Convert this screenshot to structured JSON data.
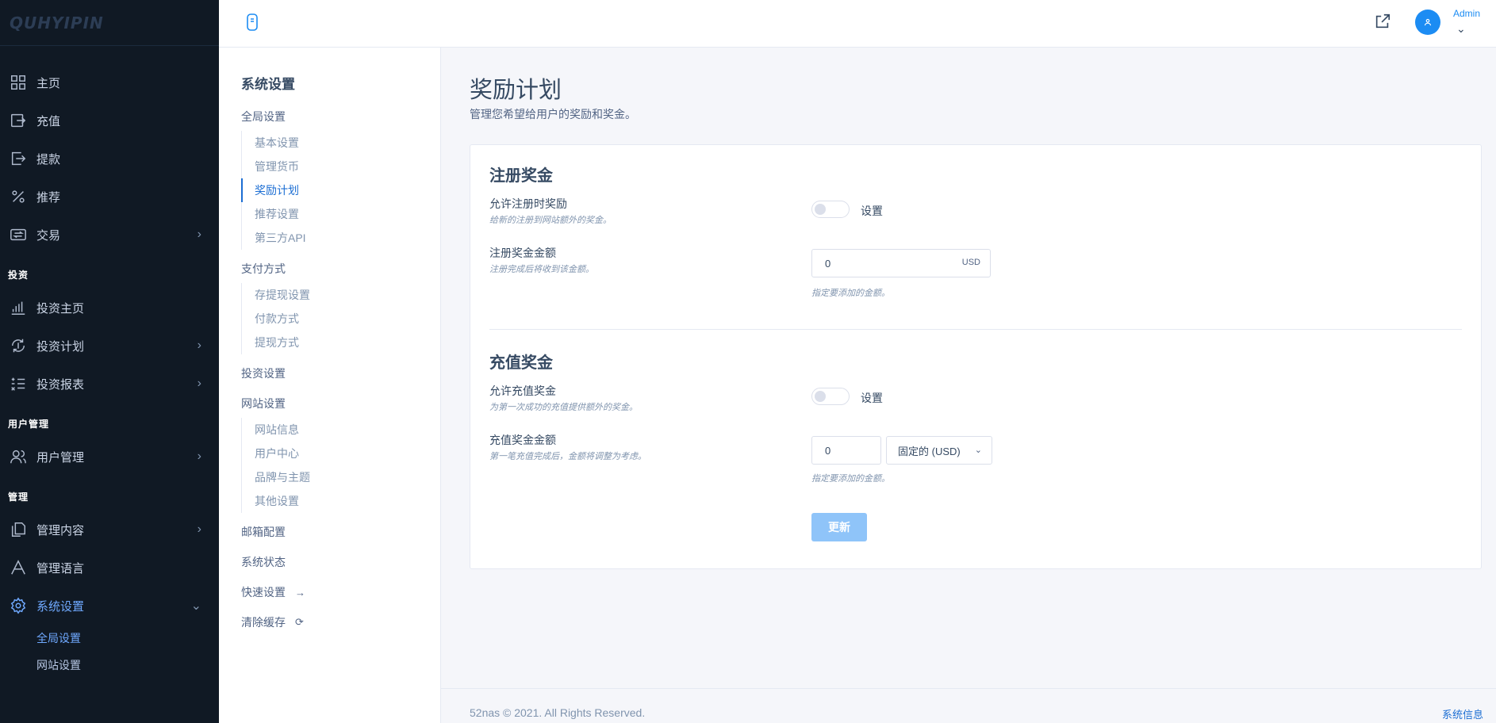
{
  "brand": {
    "name": "QUHYIPIN"
  },
  "sidebar": {
    "items": [
      {
        "label": "主页",
        "icon": "grid-icon"
      },
      {
        "label": "充值",
        "icon": "deposit-icon"
      },
      {
        "label": "提款",
        "icon": "withdraw-icon"
      },
      {
        "label": "推荐",
        "icon": "percent-icon"
      },
      {
        "label": "交易",
        "icon": "exchange-icon"
      }
    ],
    "heading_invest": "投资",
    "invest_items": [
      {
        "label": "投资主页",
        "icon": "bar-chart-icon"
      },
      {
        "label": "投资计划",
        "icon": "plan-icon"
      },
      {
        "label": "投资报表",
        "icon": "report-icon"
      }
    ],
    "heading_users": "用户管理",
    "user_items": [
      {
        "label": "用户管理",
        "icon": "users-icon"
      }
    ],
    "heading_manage": "管理",
    "manage_items": [
      {
        "label": "管理内容",
        "icon": "pages-icon"
      },
      {
        "label": "管理语言",
        "icon": "language-icon"
      },
      {
        "label": "系统设置",
        "icon": "gear-icon"
      }
    ],
    "settings_sub": [
      "全局设置",
      "网站设置"
    ]
  },
  "header": {
    "user_name": "Admin"
  },
  "submenu": {
    "title": "系统设置",
    "group_global": "全局设置",
    "global_children": [
      "基本设置",
      "管理货币",
      "奖励计划",
      "推荐设置",
      "第三方API"
    ],
    "group_payment": "支付方式",
    "payment_children": [
      "存提现设置",
      "付款方式",
      "提现方式"
    ],
    "group_invest": "投资设置",
    "group_site": "网站设置",
    "site_children": [
      "网站信息",
      "用户中心",
      "品牌与主题",
      "其他设置"
    ],
    "email": "邮箱配置",
    "status": "系统状态",
    "quick": "快速设置",
    "quick_icon": "→",
    "cache": "清除缓存",
    "cache_icon": "⟳"
  },
  "page": {
    "title": "奖励计划",
    "subtitle": "管理您希望给用户的奖励和奖金。"
  },
  "signup": {
    "title": "注册奖金",
    "allow_label": "允许注册时奖励",
    "allow_hint": "给新的注册到网站额外的奖金。",
    "toggle_label": "设置",
    "amount_label": "注册奖金金额",
    "amount_hint": "注册完成后将收到该金额。",
    "amount_value": "0",
    "amount_unit": "USD",
    "amount_help": "指定要添加的金额。"
  },
  "deposit": {
    "title": "充值奖金",
    "allow_label": "允许充值奖金",
    "allow_hint": "为第一次成功的充值提供额外的奖金。",
    "toggle_label": "设置",
    "amount_label": "充值奖金金额",
    "amount_hint": "第一笔充值完成后，金额将调整为考虑。",
    "amount_value": "0",
    "type_selected": "固定的 (USD)",
    "amount_help": "指定要添加的金额。"
  },
  "actions": {
    "update": "更新"
  },
  "footer": {
    "copyright": "52nas © 2021. All Rights Reserved.",
    "sysinfo": "系统信息"
  }
}
